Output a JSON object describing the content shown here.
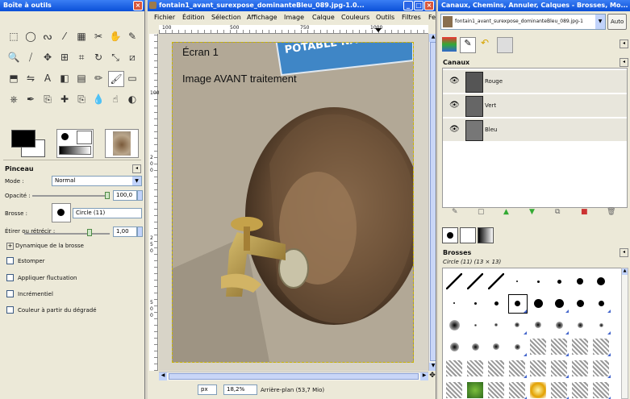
{
  "toolbox": {
    "title": "Boîte à outils",
    "section_title": "Pinceau",
    "mode_label": "Mode :",
    "mode_value": "Normal",
    "opacity_label": "Opacité :",
    "opacity_value": "100,0",
    "brush_label": "Brosse :",
    "brush_value": "Circle (11)",
    "scale_label": "Étirer ou rétrécir :",
    "scale_value": "1,00",
    "dynamics_label": "Dynamique de la brosse",
    "options": [
      "Estomper",
      "Appliquer fluctuation",
      "Incrémentiel",
      "Couleur à partir du dégradé"
    ],
    "fg_color": "#000000",
    "bg_color": "#ffffff",
    "tools": [
      "rect-select",
      "ellipse-select",
      "lasso",
      "fuzzy-select",
      "color-select",
      "scissors",
      "foreground-select",
      "color-picker",
      "zoom",
      "measure",
      "move",
      "align",
      "crop",
      "rotate",
      "scale",
      "shear",
      "perspective",
      "flip",
      "text",
      "bucket-fill",
      "blend",
      "pencil",
      "paintbrush",
      "eraser",
      "airbrush",
      "ink",
      "clone",
      "heal",
      "perspective-clone",
      "convolve",
      "smudge",
      "dodge-burn"
    ]
  },
  "image_window": {
    "title": "fontain1_avant_surexpose_dominanteBleu_089.jpg-1.0...",
    "menu": [
      "Fichier",
      "Édition",
      "Sélection",
      "Affichage",
      "Image",
      "Calque",
      "Couleurs",
      "Outils",
      "Filtres",
      "Fe"
    ],
    "ruler_top": [
      "100",
      "500",
      "750",
      "1000"
    ],
    "ruler_left": [
      "100",
      "2",
      "0",
      "0",
      "2",
      "5",
      "0",
      "5",
      "0",
      "0"
    ],
    "sign_text": "POTABLE NATUR",
    "caption_1": "Écran 1",
    "caption_2": "Image AVANT traitement",
    "unit": "px",
    "zoom": "18,2%",
    "status": "Arrière-plan (53,7 Mio)"
  },
  "layers_window": {
    "title": "Canaux, Chemins, Annuler, Calques - Brosses, Mo...",
    "image_selector": "fontain1_avant_surexpose_dominanteBleu_089.jpg-1",
    "auto_button": "Auto",
    "channels_title": "Canaux",
    "channels": [
      "Rouge",
      "Vert",
      "Bleu"
    ],
    "brushes_title": "Brosses",
    "brush_info": "Circle (11) (13 × 13)"
  }
}
